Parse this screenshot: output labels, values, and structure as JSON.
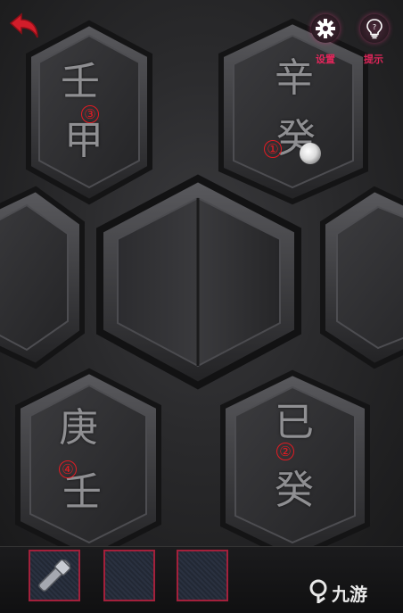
{
  "topbar": {
    "settings_label": "设置",
    "hint_label": "提示"
  },
  "tiles": [
    {
      "chars": [
        "壬",
        "甲"
      ],
      "marker": "③"
    },
    {
      "chars": [
        "辛",
        "癸"
      ],
      "marker": "①"
    },
    {
      "chars": [
        "庚",
        "壬"
      ],
      "marker": "④"
    },
    {
      "chars": [
        "已",
        "癸"
      ],
      "marker": "②"
    }
  ],
  "inventory": {
    "slots": [
      "hammer-item",
      "empty",
      "empty"
    ]
  },
  "watermark": {
    "text": "九游"
  },
  "colors": {
    "accent": "#e0265a",
    "marker": "#e21b23",
    "slot_border": "#a3203b"
  }
}
